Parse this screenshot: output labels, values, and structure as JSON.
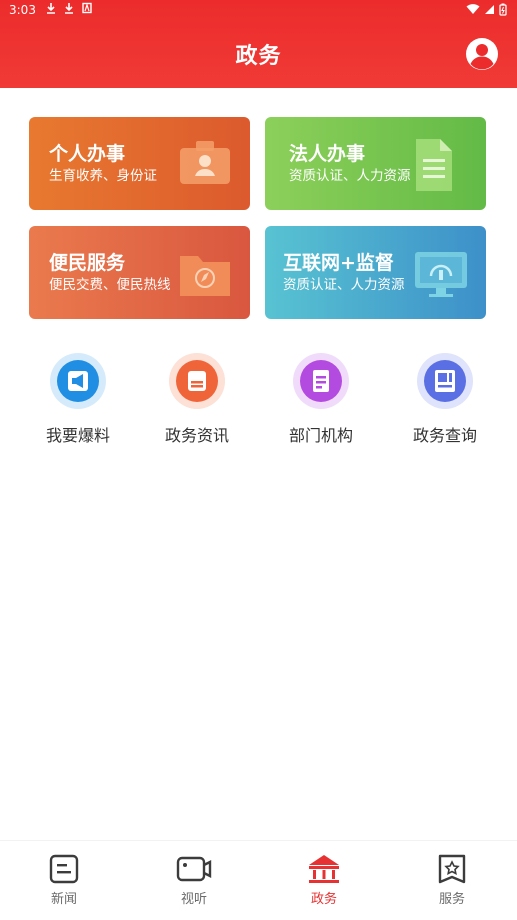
{
  "status_bar": {
    "time": "3:03"
  },
  "header": {
    "title": "政务"
  },
  "cards": [
    {
      "title": "个人办事",
      "subtitle": "生育收养、身份证",
      "color": "#e0632f",
      "icon": "id-card-icon"
    },
    {
      "title": "法人办事",
      "subtitle": "资质认证、人力资源",
      "color": "#71c14c",
      "icon": "document-icon"
    },
    {
      "title": "便民服务",
      "subtitle": "便民交费、便民热线",
      "color": "#e26846",
      "icon": "folder-compass-icon"
    },
    {
      "title": "互联网+监督",
      "subtitle": "资质认证、人力资源",
      "color": "#4aa8cd",
      "icon": "monitor-icon"
    }
  ],
  "quick_links": [
    {
      "label": "我要爆料",
      "color": "#1f8ee3",
      "icon": "megaphone-icon"
    },
    {
      "label": "政务资讯",
      "color": "#f0643a",
      "icon": "news-icon"
    },
    {
      "label": "部门机构",
      "color": "#b44be0",
      "icon": "department-icon"
    },
    {
      "label": "政务查询",
      "color": "#5a6fe3",
      "icon": "query-icon"
    }
  ],
  "bottom_nav": [
    {
      "label": "新闻",
      "icon": "news-nav-icon",
      "active": false
    },
    {
      "label": "视听",
      "icon": "video-nav-icon",
      "active": false
    },
    {
      "label": "政务",
      "icon": "government-nav-icon",
      "active": true
    },
    {
      "label": "服务",
      "icon": "service-nav-icon",
      "active": false
    }
  ],
  "colors": {
    "brand_red": "#ec2c2c",
    "active_nav": "#e63232"
  }
}
